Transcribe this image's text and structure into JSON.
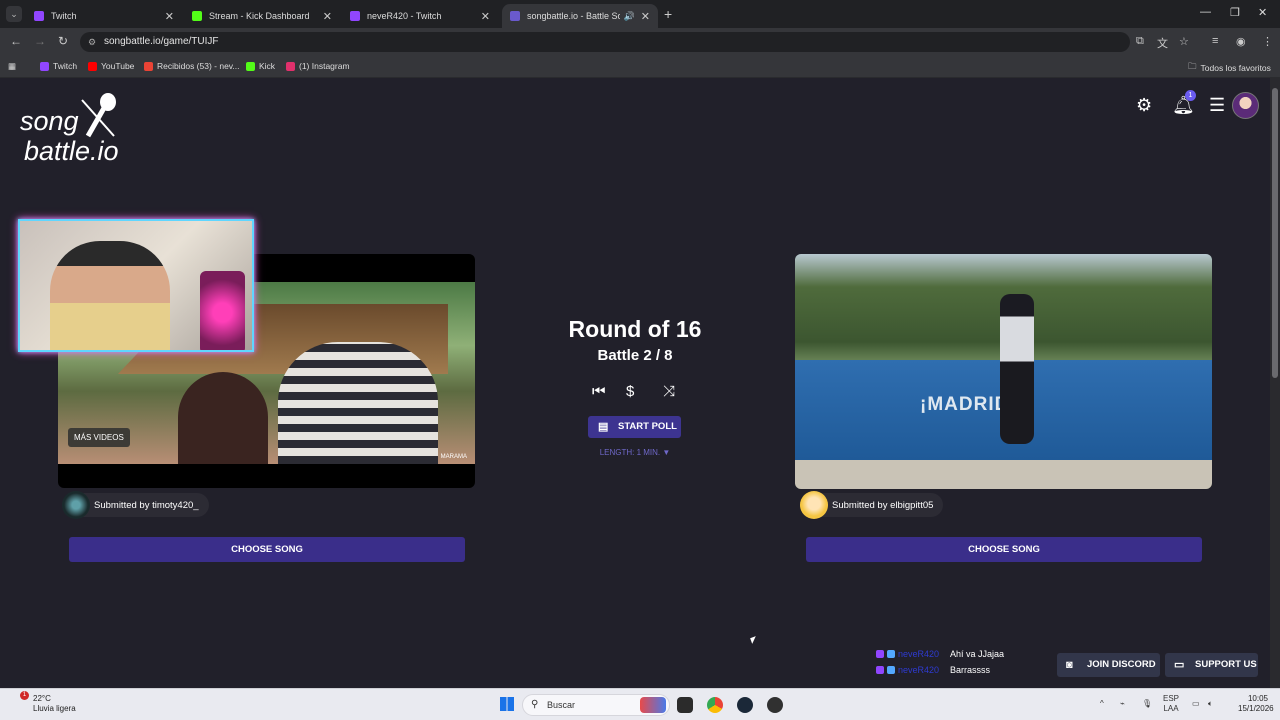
{
  "browser": {
    "tabs": [
      {
        "title": "Twitch",
        "color": "#9146ff"
      },
      {
        "title": "Stream - Kick Dashboard",
        "color": "#53fc18"
      },
      {
        "title": "neveR420 - Twitch",
        "color": "#9146ff"
      },
      {
        "title": "songbattle.io - Battle Songs",
        "color": "#6a5acd",
        "audio": true
      }
    ],
    "url": "songbattle.io/game/TUIJF",
    "bookmarks": [
      {
        "label": "Twitch",
        "color": "#9146ff"
      },
      {
        "label": "YouTube",
        "color": "#ff0000"
      },
      {
        "label": "Recibidos (53) - nev...",
        "color": "#ea4335"
      },
      {
        "label": "Kick",
        "color": "#53fc18"
      },
      {
        "label": "(1) Instagram",
        "color": "#e1306c"
      }
    ],
    "all_bookmarks": "Todos los favoritos"
  },
  "site": {
    "logo_line1": "song",
    "logo_line2": "battle.io",
    "notifications_count": "1"
  },
  "game": {
    "round_title": "Round of 16",
    "battle_label": "Battle 2 / 8",
    "start_poll_label": "START POLL",
    "length_label": "LENGTH: 1 MIN. ▼",
    "left": {
      "more_videos": "MÁS VIDEOS",
      "watermark": "MARAMA",
      "submitted_by": "Submitted by timoty420_",
      "choose_label": "CHOOSE SONG"
    },
    "right": {
      "sign_text": "¡MADRID!",
      "submitted_by": "Submitted by elbigpitt05",
      "choose_label": "CHOOSE SONG"
    }
  },
  "chat": [
    {
      "user": "neveR420",
      "message": "Ahí va JJajaa"
    },
    {
      "user": "neveR420",
      "message": "Barrassss"
    }
  ],
  "footer": {
    "discord_label": "JOIN DISCORD",
    "support_label": "SUPPORT US"
  },
  "taskbar": {
    "weather_temp": "22°C",
    "weather_desc": "Lluvia ligera",
    "weather_badge": "1",
    "search_placeholder": "Buscar",
    "lang_line1": "ESP",
    "lang_line2": "LAA",
    "time": "10:05",
    "date": "15/1/2026"
  }
}
